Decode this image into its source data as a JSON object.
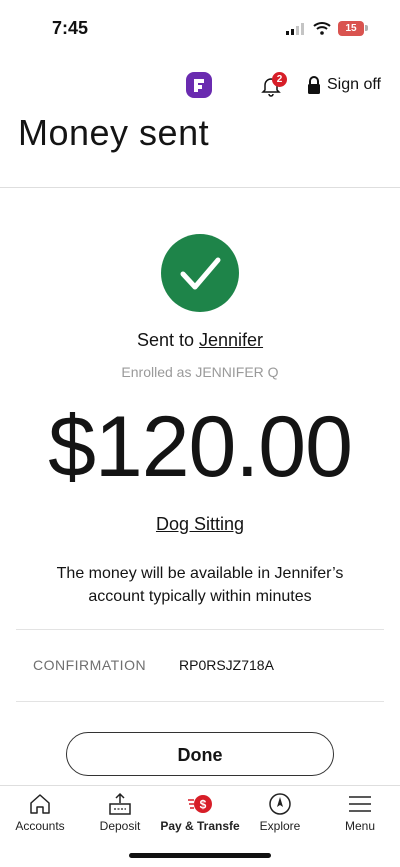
{
  "status_bar": {
    "time": "7:45",
    "battery": "15"
  },
  "header": {
    "notification_count": "2",
    "signoff_label": "Sign off",
    "title": "Money sent"
  },
  "confirmation": {
    "sent_to_prefix": "Sent to ",
    "recipient": "Jennifer",
    "enrolled_as": "Enrolled as JENNIFER Q",
    "amount": "$120.00",
    "memo": "Dog Sitting",
    "availability_note": "The money will be available in Jennifer’s account typically within minutes",
    "confirmation_label": "CONFIRMATION",
    "confirmation_number": "RP0RSJZ718A",
    "done_label": "Done",
    "success_color": "#1e8449"
  },
  "bottom_nav": {
    "items": [
      {
        "label": "Accounts",
        "icon": "home-icon"
      },
      {
        "label": "Deposit",
        "icon": "deposit-icon"
      },
      {
        "label": "Pay & Transfe",
        "icon": "pay-transfer-icon",
        "active": true
      },
      {
        "label": "Explore",
        "icon": "compass-icon"
      },
      {
        "label": "Menu",
        "icon": "menu-icon"
      }
    ]
  }
}
